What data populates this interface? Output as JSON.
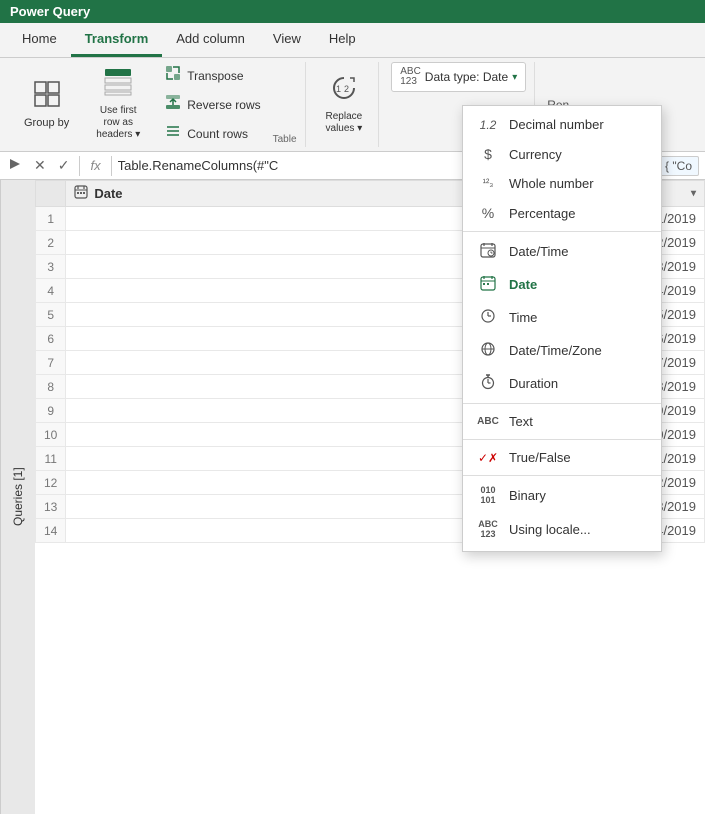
{
  "app": {
    "title": "Power Query"
  },
  "tabs": [
    {
      "label": "Home",
      "active": false
    },
    {
      "label": "Transform",
      "active": true
    },
    {
      "label": "Add column",
      "active": false
    },
    {
      "label": "View",
      "active": false
    },
    {
      "label": "Help",
      "active": false
    }
  ],
  "ribbon": {
    "groups": [
      {
        "name": "table",
        "label": "Table",
        "buttons": [
          {
            "label": "Group by",
            "icon": "⊞"
          },
          {
            "label": "Use first row as headers",
            "icon": "⬛"
          },
          {
            "subgroup": [
              {
                "label": "Transpose",
                "icon": "⟺"
              },
              {
                "label": "Reverse rows",
                "icon": "↕"
              },
              {
                "label": "Count rows",
                "icon": "≡"
              }
            ]
          }
        ]
      }
    ],
    "replace_values": {
      "label": "Replace\nvalues",
      "icon": "↺"
    },
    "datatype_btn": {
      "label": "Data type: Date",
      "prefix": "ABC\n123"
    },
    "partial_right": "Ren"
  },
  "formula_bar": {
    "expand_icon": "▷",
    "cancel_icon": "✕",
    "confirm_icon": "✓",
    "fx_label": "fx",
    "formula": "Table.RenameColumns(#\"C",
    "result_preview": "{ \"Co"
  },
  "queries_panel": {
    "label": "Queries [1]"
  },
  "table": {
    "column_type_icon": "📅",
    "column_name": "Date",
    "rows": [
      {
        "num": 1,
        "value": "1/1/2019"
      },
      {
        "num": 2,
        "value": "1/2/2019"
      },
      {
        "num": 3,
        "value": "1/3/2019"
      },
      {
        "num": 4,
        "value": "1/4/2019"
      },
      {
        "num": 5,
        "value": "1/5/2019"
      },
      {
        "num": 6,
        "value": "1/6/2019"
      },
      {
        "num": 7,
        "value": "1/7/2019"
      },
      {
        "num": 8,
        "value": "1/8/2019"
      },
      {
        "num": 9,
        "value": "1/9/2019"
      },
      {
        "num": 10,
        "value": "1/10/2019"
      },
      {
        "num": 11,
        "value": "1/11/2019"
      },
      {
        "num": 12,
        "value": "1/12/2019"
      },
      {
        "num": 13,
        "value": "1/13/2019"
      },
      {
        "num": 14,
        "value": "1/14/2019"
      }
    ]
  },
  "dropdown_menu": {
    "items": [
      {
        "id": "decimal",
        "icon": "1.2",
        "label": "Decimal number",
        "sep_after": false
      },
      {
        "id": "currency",
        "icon": "$",
        "label": "Currency",
        "sep_after": false
      },
      {
        "id": "whole",
        "icon": "¹²₃",
        "label": "Whole number",
        "sep_after": false
      },
      {
        "id": "percentage",
        "icon": "%",
        "label": "Percentage",
        "sep_after": false
      },
      {
        "id": "datetime",
        "icon": "📅",
        "label": "Date/Time",
        "sep_after": false
      },
      {
        "id": "date",
        "icon": "📅",
        "label": "Date",
        "sep_after": false,
        "active": true
      },
      {
        "id": "time",
        "icon": "🕐",
        "label": "Time",
        "sep_after": false
      },
      {
        "id": "datetimezone",
        "icon": "🌐",
        "label": "Date/Time/Zone",
        "sep_after": false
      },
      {
        "id": "duration",
        "icon": "⏱",
        "label": "Duration",
        "sep_after": true
      },
      {
        "id": "text",
        "icon": "ABC",
        "label": "Text",
        "sep_after": true
      },
      {
        "id": "truefalse",
        "icon": "✓✗",
        "label": "True/False",
        "sep_after": true
      },
      {
        "id": "binary",
        "icon": "010\n101",
        "label": "Binary",
        "sep_after": false
      },
      {
        "id": "locale",
        "icon": "ABC\n123",
        "label": "Using locale...",
        "sep_after": false
      }
    ]
  }
}
